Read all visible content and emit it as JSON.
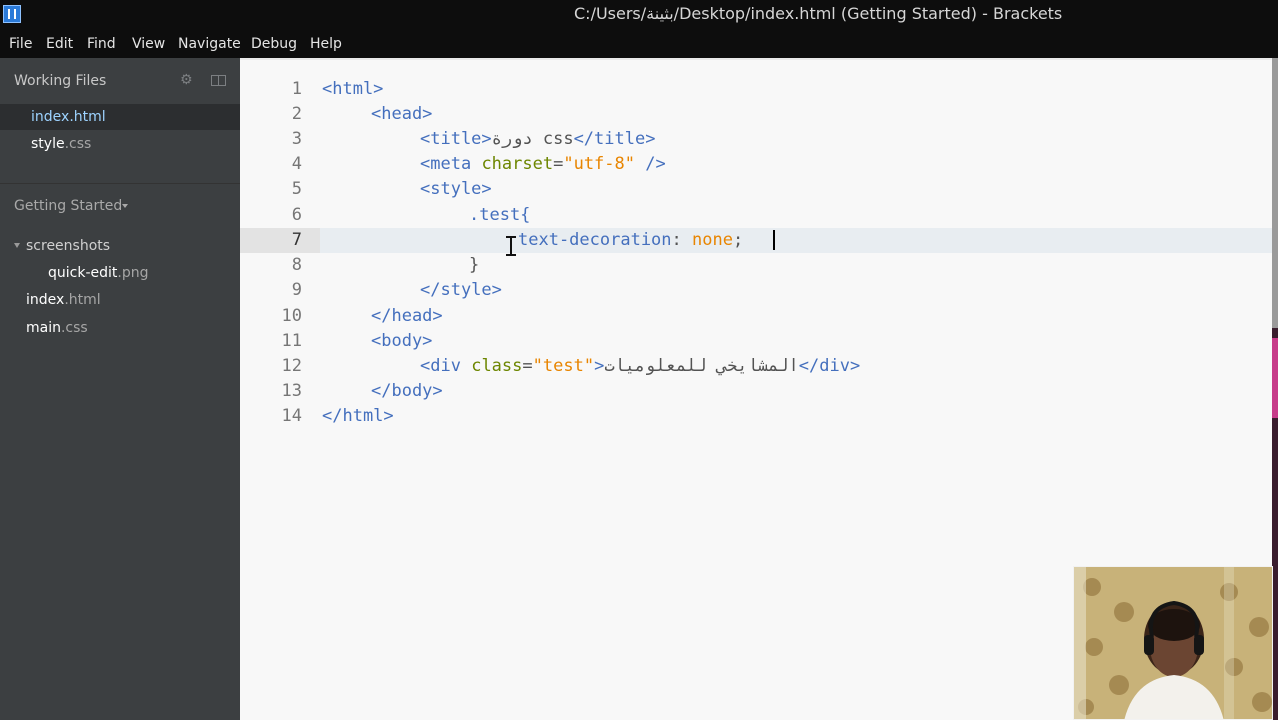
{
  "window": {
    "title": "C:/Users/بثينة/Desktop/index.html (Getting Started) - Brackets"
  },
  "menu": [
    "File",
    "Edit",
    "Find",
    "View",
    "Navigate",
    "Debug",
    "Help"
  ],
  "sidebar": {
    "working_files_label": "Working Files",
    "working_files": [
      {
        "name": "index",
        "ext": ".html",
        "active": true
      },
      {
        "name": "style",
        "ext": ".css",
        "active": false
      }
    ],
    "project_label": "Getting Started",
    "tree": [
      {
        "name": "screenshots",
        "ext": "",
        "type": "folder"
      },
      {
        "name": "quick-edit",
        "ext": ".png",
        "type": "file"
      },
      {
        "name": "index",
        "ext": ".html",
        "type": "file"
      },
      {
        "name": "main",
        "ext": ".css",
        "type": "file"
      }
    ]
  },
  "editor": {
    "active_line": 7,
    "line_numbers": [
      "1",
      "2",
      "3",
      "4",
      "5",
      "6",
      "7",
      "8",
      "9",
      "10",
      "11",
      "12",
      "13",
      "14"
    ],
    "lines": {
      "l1": {
        "tag": "<html>"
      },
      "l2": {
        "tag": "<head>"
      },
      "l3": {
        "open": "<title>",
        "text": "دورة css",
        "close": "</title>"
      },
      "l4": {
        "tag": "<meta",
        "attr": "charset",
        "eq": "=",
        "str": "\"utf-8\"",
        "end": " />"
      },
      "l5": {
        "tag": "<style>"
      },
      "l6": {
        "selector": ".test{"
      },
      "l7": {
        "prop": "text-decoration",
        "colon": ": ",
        "value": "none",
        "semi": ";"
      },
      "l8": {
        "brace": "}"
      },
      "l9": {
        "tag": "</style>"
      },
      "l10": {
        "tag": "</head>"
      },
      "l11": {
        "tag": "<body>"
      },
      "l12": {
        "open": "<div",
        "attr": "class",
        "eq": "=",
        "str": "\"test\"",
        "gt": ">",
        "text": "المشايخي للمعلوميات",
        "close": "</div>"
      },
      "l13": {
        "tag": "</body>"
      },
      "l14": {
        "tag": "</html>"
      }
    }
  },
  "colors": {
    "tag": "#446fbd",
    "attribute": "#6d8600",
    "string": "#e88501",
    "active_file": "#9dd3ff"
  }
}
